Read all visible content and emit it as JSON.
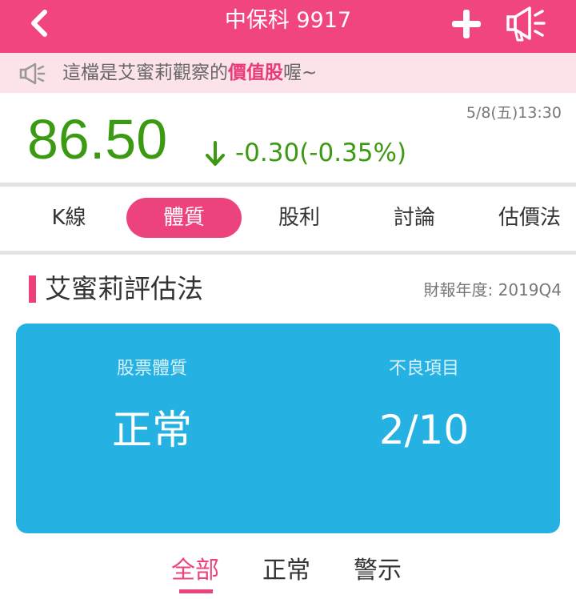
{
  "header": {
    "title": "中保科 9917",
    "back_icon": "chevron-left-icon",
    "add_icon": "plus-icon",
    "speaker_icon": "megaphone-icon",
    "bg_color": "#f0457f"
  },
  "notice": {
    "icon": "megaphone-icon",
    "text_before": "這檔是艾蜜莉觀察的",
    "highlight": "價值股",
    "text_after": "喔~"
  },
  "quote": {
    "price": "86.50",
    "change": "-0.30(-0.35%)",
    "direction_icon": "arrow-down-icon",
    "timestamp": "5/8(五)13:30",
    "color": "#3b9a12"
  },
  "tabs": [
    {
      "label": "K線",
      "active": false
    },
    {
      "label": "體質",
      "active": true
    },
    {
      "label": "股利",
      "active": false
    },
    {
      "label": "討論",
      "active": false
    },
    {
      "label": "估價法",
      "active": false
    }
  ],
  "section": {
    "title": "艾蜜莉評估法",
    "report_date": "財報年度: 2019Q4"
  },
  "summary_card": {
    "left_label": "股票體質",
    "left_value": "正常",
    "right_label": "不良項目",
    "right_value": "2/10",
    "bg_color": "#25b1e1"
  },
  "filters": [
    {
      "label": "全部",
      "active": true
    },
    {
      "label": "正常",
      "active": false
    },
    {
      "label": "警示",
      "active": false
    }
  ]
}
